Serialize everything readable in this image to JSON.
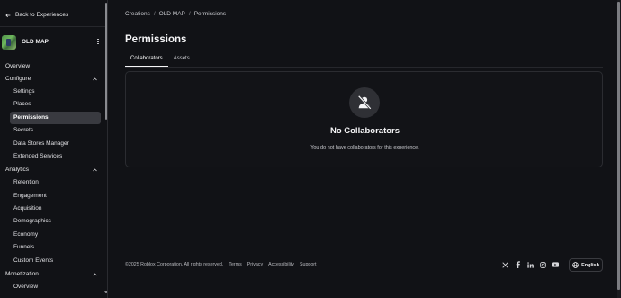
{
  "sidebar": {
    "back_label": "Back to Experiences",
    "experience_name": "OLD MAP",
    "overview": "Overview",
    "configure": {
      "label": "Configure",
      "items": [
        "Settings",
        "Places",
        "Permissions",
        "Secrets",
        "Data Stores Manager",
        "Extended Services"
      ],
      "active": "Permissions"
    },
    "analytics": {
      "label": "Analytics",
      "items": [
        "Retention",
        "Engagement",
        "Acquisition",
        "Demographics",
        "Economy",
        "Funnels",
        "Custom Events"
      ]
    },
    "monetization": {
      "label": "Monetization",
      "items": [
        "Overview"
      ]
    }
  },
  "breadcrumb": [
    "Creations",
    "OLD MAP",
    "Permissions"
  ],
  "breadcrumb_separator": "/",
  "page_title": "Permissions",
  "tabs": [
    {
      "label": "Collaborators",
      "active": true
    },
    {
      "label": "Assets",
      "active": false
    }
  ],
  "empty_state": {
    "icon": "no-collaborators-icon",
    "title": "No Collaborators",
    "description": "You do not have collaborators for this experience."
  },
  "footer": {
    "copyright": "©2025 Roblox Corporation. All rights reserved.",
    "links": [
      "Terms",
      "Privacy",
      "Accessibility",
      "Support"
    ],
    "socials": [
      "x-icon",
      "facebook-icon",
      "linkedin-icon",
      "instagram-icon",
      "youtube-icon"
    ],
    "language": "English"
  },
  "colors": {
    "background": "#111216",
    "active_item": "#393a40",
    "text": "#e8e8ea"
  }
}
